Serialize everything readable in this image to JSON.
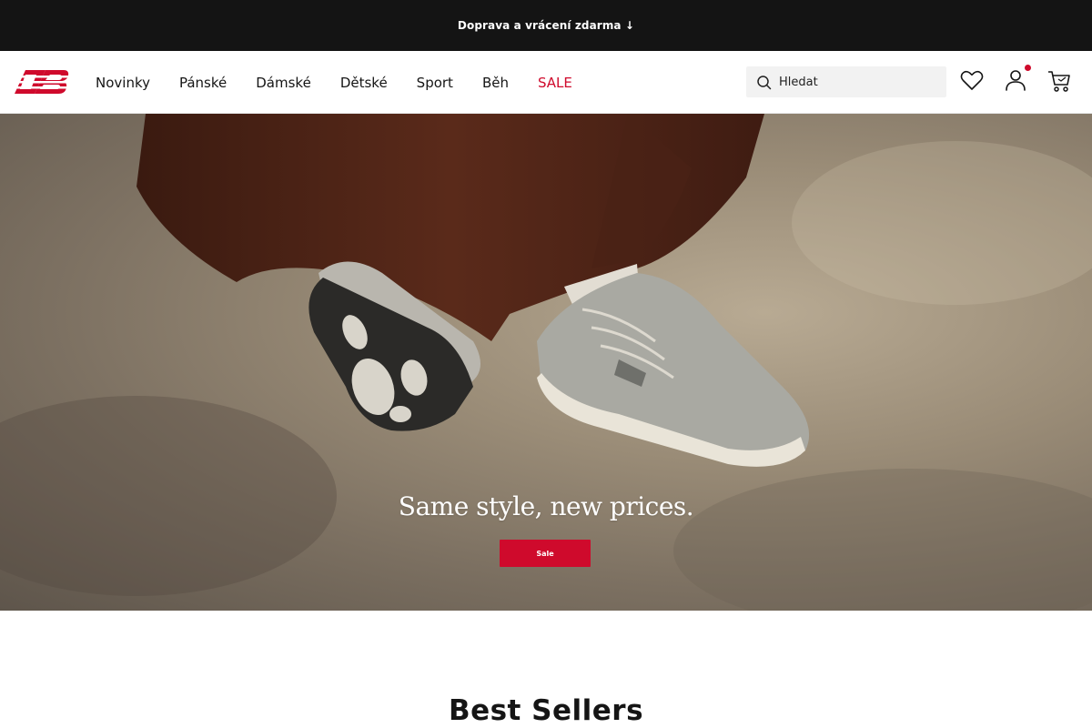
{
  "promo": {
    "text": "Doprava a vrácení zdarma ↓"
  },
  "header": {
    "logo_name": "new-balance-logo",
    "nav": [
      {
        "label": "Novinky"
      },
      {
        "label": "Pánské"
      },
      {
        "label": "Dámské"
      },
      {
        "label": "Dětské"
      },
      {
        "label": "Sport"
      },
      {
        "label": "Běh"
      },
      {
        "label": "SALE"
      }
    ],
    "search": {
      "placeholder": "Hledat"
    },
    "icons": [
      "search-icon",
      "heart-icon",
      "user-icon",
      "cart-icon"
    ],
    "account_has_notification": true
  },
  "hero": {
    "title": "Same style, new prices.",
    "button_label": "Sale"
  },
  "section": {
    "title": "Best Sellers"
  },
  "colors": {
    "brand_red": "#cf0a2c",
    "promo_bg": "#141414",
    "search_bg": "#f2f2f2"
  }
}
